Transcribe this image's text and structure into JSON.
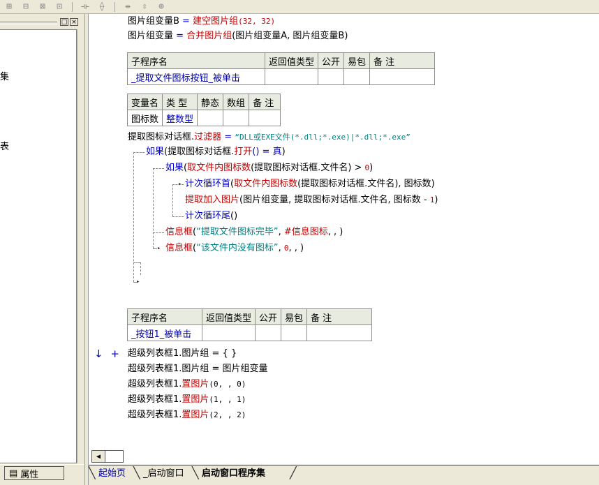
{
  "toolbar": {
    "icons": [
      "align-left-icon",
      "align-center-icon",
      "align-top-icon",
      "align-middle-icon",
      "distribute-h-icon",
      "distribute-v-icon",
      "same-width-icon",
      "same-height-icon",
      "same-size-icon"
    ]
  },
  "left_panel": {
    "tree_fragments": [
      "集",
      "表"
    ],
    "minimize_label": "□",
    "close_label": "×",
    "property_tab_label": "属性"
  },
  "code": {
    "line1": {
      "var": "图片组变量B",
      "eq": " = ",
      "fn": "建空图片组",
      "args": "(32, 32)"
    },
    "line2": {
      "var": "图片组变量",
      "eq": " = ",
      "fn": "合并图片组",
      "args": "(图片组变量A, 图片组变量B)"
    },
    "sub1_table": {
      "headers": [
        "子程序名",
        "返回值类型",
        "公开",
        "易包",
        "备 注"
      ],
      "row": [
        "_提取文件图标按钮_被单击",
        "",
        "",
        "",
        ""
      ]
    },
    "var_table": {
      "headers": [
        "变量名",
        "类 型",
        "静态",
        "数组",
        "备 注"
      ],
      "row": [
        "图标数",
        "整数型",
        "",
        "",
        ""
      ]
    },
    "line3": {
      "obj": "提取图标对话框.",
      "prop": "过滤器",
      "eq": " = ",
      "str": "“DLL或EXE文件(*.dll;*.exe)|*.dll;*.exe”"
    },
    "line4": {
      "kw": "如果",
      "a": "(提取图标对话框.",
      "fn": "打开",
      "b": "() = ",
      "val": "真",
      ")": ")"
    },
    "line5": {
      "kw": "如果",
      "a": "(",
      "fn": "取文件内图标数",
      "b": "(提取图标对话框.文件名) > ",
      "num": "0",
      ")": ")"
    },
    "line6": {
      "kw": "计次循环首",
      "a": "(",
      "fn": "取文件内图标数",
      "b": "(提取图标对话框.文件名), 图标数)"
    },
    "line7": {
      "fn": "提取加入图片",
      "a": "(图片组变量, 提取图标对话框.文件名, 图标数 - ",
      "num": "1",
      ")": ")"
    },
    "line8": {
      "kw": "计次循环尾",
      "a": "()"
    },
    "line9": {
      "fn": "信息框",
      "a": "(",
      "str": "“提取文件图标完毕”",
      ", ": ", ",
      "const": "#信息图标",
      ",,": ", , )"
    },
    "line10": {
      "fn": "信息框",
      "a": "(",
      "str": "“该文件内没有图标”",
      ", ": ", ",
      "num": "0",
      ",,": ", , )"
    },
    "sub2_table": {
      "headers": [
        "子程序名",
        "返回值类型",
        "公开",
        "易包",
        "备 注"
      ],
      "row": [
        "_按钮1_被单击",
        "",
        "",
        "",
        ""
      ]
    },
    "line11": {
      "a": "超级列表框1.图片组 = { }"
    },
    "line12": {
      "a": "超级列表框1.图片组 = 图片组变量"
    },
    "line13": {
      "a": "超级列表框1.",
      "fn": "置图片",
      "args": "(0, , 0)"
    },
    "line14": {
      "a": "超级列表框1.",
      "fn": "置图片",
      "args": "(1, , 1)"
    },
    "line15": {
      "a": "超级列表框1.",
      "fn": "置图片",
      "args": "(2, , 2)"
    }
  },
  "margin": {
    "arrow": "↓",
    "plus": "+"
  },
  "tabs": [
    {
      "label": "起始页"
    },
    {
      "label": "_启动窗口"
    },
    {
      "label": "启动窗口程序集"
    }
  ],
  "colors": {
    "keyword": "#0000c8",
    "function": "#c00000",
    "string": "#008080",
    "number": "#c00000"
  }
}
